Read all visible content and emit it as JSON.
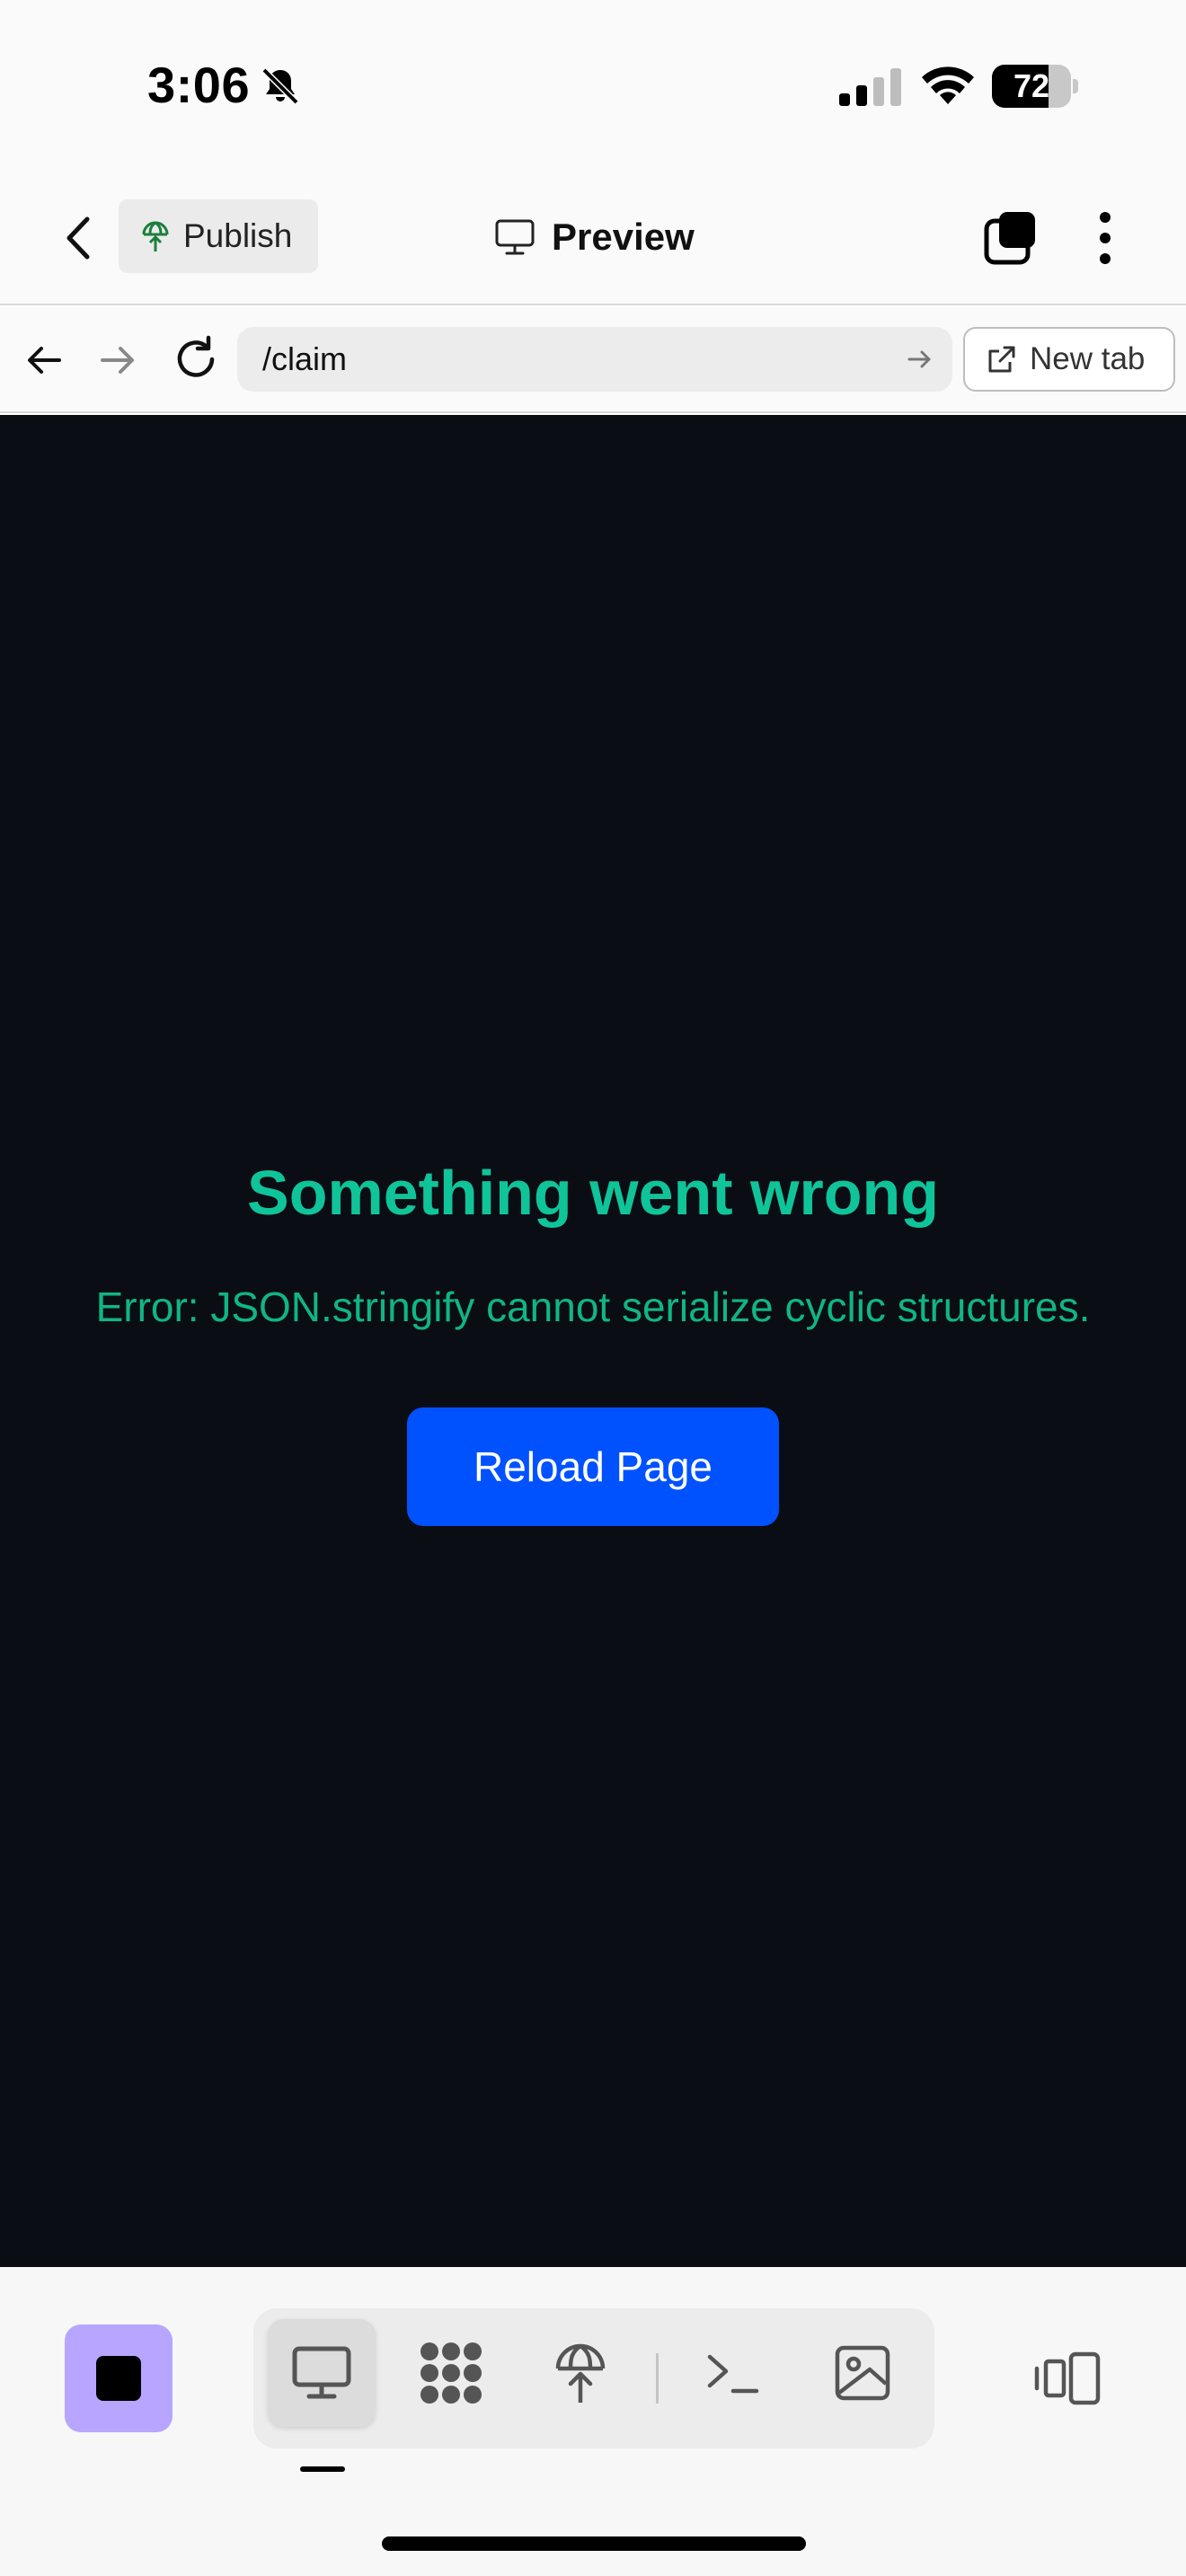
{
  "status_bar": {
    "time": "3:06",
    "battery_percent": "72",
    "battery_level": 0.72
  },
  "header": {
    "publish_label": "Publish",
    "title": "Preview"
  },
  "browser": {
    "url": "/claim",
    "new_tab_label": "New tab"
  },
  "error": {
    "title": "Something went wrong",
    "message": "Error: JSON.stringify cannot serialize cyclic structures.",
    "reload_label": "Reload Page"
  },
  "colors": {
    "preview_bg": "#0a0d14",
    "error_accent": "#10c49a",
    "button_blue": "#0052ff",
    "stop_purple": "#b7a5ff"
  },
  "toolbar": {
    "tools": [
      "desktop-icon",
      "extensions-icon",
      "publish-icon",
      "terminal-icon",
      "image-icon"
    ],
    "active_tool": "desktop-icon"
  }
}
